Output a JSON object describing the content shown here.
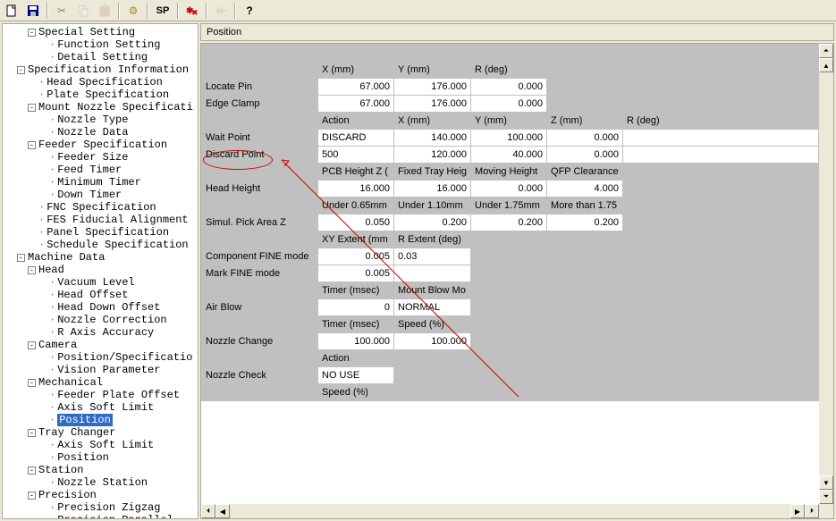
{
  "toolbar": {
    "new": "new-file-icon",
    "save": "save-icon",
    "cut": "cut-icon",
    "copy": "copy-icon",
    "paste": "paste-icon",
    "gear": "gear-icon",
    "sp": "SP",
    "debug": "debug-icon",
    "tune": "tune-icon",
    "help": "?"
  },
  "tree": [
    {
      "d": 2,
      "box": "-",
      "label": "Special Setting"
    },
    {
      "d": 4,
      "box": "",
      "label": "Function Setting"
    },
    {
      "d": 4,
      "box": "",
      "label": "Detail Setting"
    },
    {
      "d": 1,
      "box": "-",
      "label": "Specification Information"
    },
    {
      "d": 3,
      "box": "",
      "label": "Head Specification"
    },
    {
      "d": 3,
      "box": "",
      "label": "Plate Specification"
    },
    {
      "d": 2,
      "box": "-",
      "label": "Mount Nozzle Specificati"
    },
    {
      "d": 4,
      "box": "",
      "label": "Nozzle Type"
    },
    {
      "d": 4,
      "box": "",
      "label": "Nozzle Data"
    },
    {
      "d": 2,
      "box": "-",
      "label": "Feeder Specification"
    },
    {
      "d": 4,
      "box": "",
      "label": "Feeder Size"
    },
    {
      "d": 4,
      "box": "",
      "label": "Feed Timer"
    },
    {
      "d": 4,
      "box": "",
      "label": "Minimum Timer"
    },
    {
      "d": 4,
      "box": "",
      "label": "Down Timer"
    },
    {
      "d": 3,
      "box": "",
      "label": "FNC Specification"
    },
    {
      "d": 3,
      "box": "",
      "label": "FES Fiducial Alignment"
    },
    {
      "d": 3,
      "box": "",
      "label": "Panel Specification"
    },
    {
      "d": 3,
      "box": "",
      "label": "Schedule Specification"
    },
    {
      "d": 1,
      "box": "-",
      "label": "Machine Data"
    },
    {
      "d": 2,
      "box": "-",
      "label": "Head"
    },
    {
      "d": 4,
      "box": "",
      "label": "Vacuum Level"
    },
    {
      "d": 4,
      "box": "",
      "label": "Head Offset"
    },
    {
      "d": 4,
      "box": "",
      "label": "Head Down Offset"
    },
    {
      "d": 4,
      "box": "",
      "label": "Nozzle Correction"
    },
    {
      "d": 4,
      "box": "",
      "label": "R Axis Accuracy"
    },
    {
      "d": 2,
      "box": "-",
      "label": "Camera"
    },
    {
      "d": 4,
      "box": "",
      "label": "Position/Specificatio"
    },
    {
      "d": 4,
      "box": "",
      "label": "Vision Parameter"
    },
    {
      "d": 2,
      "box": "-",
      "label": "Mechanical"
    },
    {
      "d": 4,
      "box": "",
      "label": "Feeder Plate Offset"
    },
    {
      "d": 4,
      "box": "",
      "label": "Axis Soft Limit"
    },
    {
      "d": 4,
      "box": "",
      "label": "Position",
      "sel": true
    },
    {
      "d": 2,
      "box": "-",
      "label": "Tray Changer"
    },
    {
      "d": 4,
      "box": "",
      "label": "Axis Soft Limit"
    },
    {
      "d": 4,
      "box": "",
      "label": "Position"
    },
    {
      "d": 2,
      "box": "-",
      "label": "Station"
    },
    {
      "d": 4,
      "box": "",
      "label": "Nozzle Station"
    },
    {
      "d": 2,
      "box": "-",
      "label": "Precision"
    },
    {
      "d": 4,
      "box": "",
      "label": "Precision Zigzag"
    },
    {
      "d": 4,
      "box": "",
      "label": "Precision Parallel"
    }
  ],
  "panel_title": "Position",
  "hdr1": {
    "c1": "X (mm)",
    "c2": "Y (mm)",
    "c3": "R (deg)",
    "c4": "",
    "c5": ""
  },
  "rows1": [
    {
      "label": "Locate Pin",
      "c1": "67.000",
      "c2": "176.000",
      "c3": "0.000"
    },
    {
      "label": "Edge Clamp",
      "c1": "67.000",
      "c2": "176.000",
      "c3": "0.000"
    }
  ],
  "hdr2": {
    "c1": "Action",
    "c2": "X (mm)",
    "c3": "Y (mm)",
    "c4": "Z (mm)",
    "c5": "R (deg)"
  },
  "rows2": [
    {
      "label": "Wait Point",
      "c1": "DISCARD",
      "c2": "140.000",
      "c3": "100.000",
      "c4": "0.000",
      "c5": ""
    },
    {
      "label": "Discard Point",
      "c1": "500",
      "c2": "120.000",
      "c3": "40.000",
      "c4": "0.000",
      "c5": ""
    }
  ],
  "hdr3": {
    "c1": "PCB Height Z (",
    "c2": "Fixed Tray Heig",
    "c3": "Moving Height",
    "c4": "QFP Clearance",
    "c5": ""
  },
  "rows3": [
    {
      "label": "Head Height",
      "c1": "16.000",
      "c2": "16.000",
      "c3": "0.000",
      "c4": "4.000",
      "c5": ""
    }
  ],
  "hdr4": {
    "c1": "Under 0.65mm",
    "c2": "Under 1.10mm",
    "c3": "Under 1.75mm",
    "c4": "More than 1.75",
    "c5": ""
  },
  "rows4": [
    {
      "label": "Simul. Pick Area Z",
      "c1": "0.050",
      "c2": "0.200",
      "c3": "0.200",
      "c4": "0.200",
      "c5": ""
    }
  ],
  "hdr5": {
    "c1": "XY Extent (mm",
    "c2": "R Extent (deg)",
    "c3": "",
    "c4": "",
    "c5": ""
  },
  "rows5": [
    {
      "label": "Component FINE mode",
      "c1": "0.005",
      "c2": "0.03"
    },
    {
      "label": "Mark FINE mode",
      "c1": "0.005",
      "c2": ""
    }
  ],
  "hdr6": {
    "c1": "Timer (msec)",
    "c2": "Mount Blow Mo",
    "c3": "",
    "c4": "",
    "c5": ""
  },
  "rows6": [
    {
      "label": "Air Blow",
      "c1": "0",
      "c2": "NORMAL"
    }
  ],
  "hdr7": {
    "c1": "Timer (msec)",
    "c2": "Speed (%)",
    "c3": "",
    "c4": "",
    "c5": ""
  },
  "rows7": [
    {
      "label": "Nozzle Change",
      "c1": "100.000",
      "c2": "100.000"
    }
  ],
  "hdr8": {
    "c1": "Action",
    "c2": "",
    "c3": "",
    "c4": "",
    "c5": ""
  },
  "rows8": [
    {
      "label": "Nozzle Check",
      "c1": "NO USE"
    }
  ],
  "hdr9": {
    "c1": "Speed (%)",
    "c2": "",
    "c3": "",
    "c4": "",
    "c5": ""
  }
}
